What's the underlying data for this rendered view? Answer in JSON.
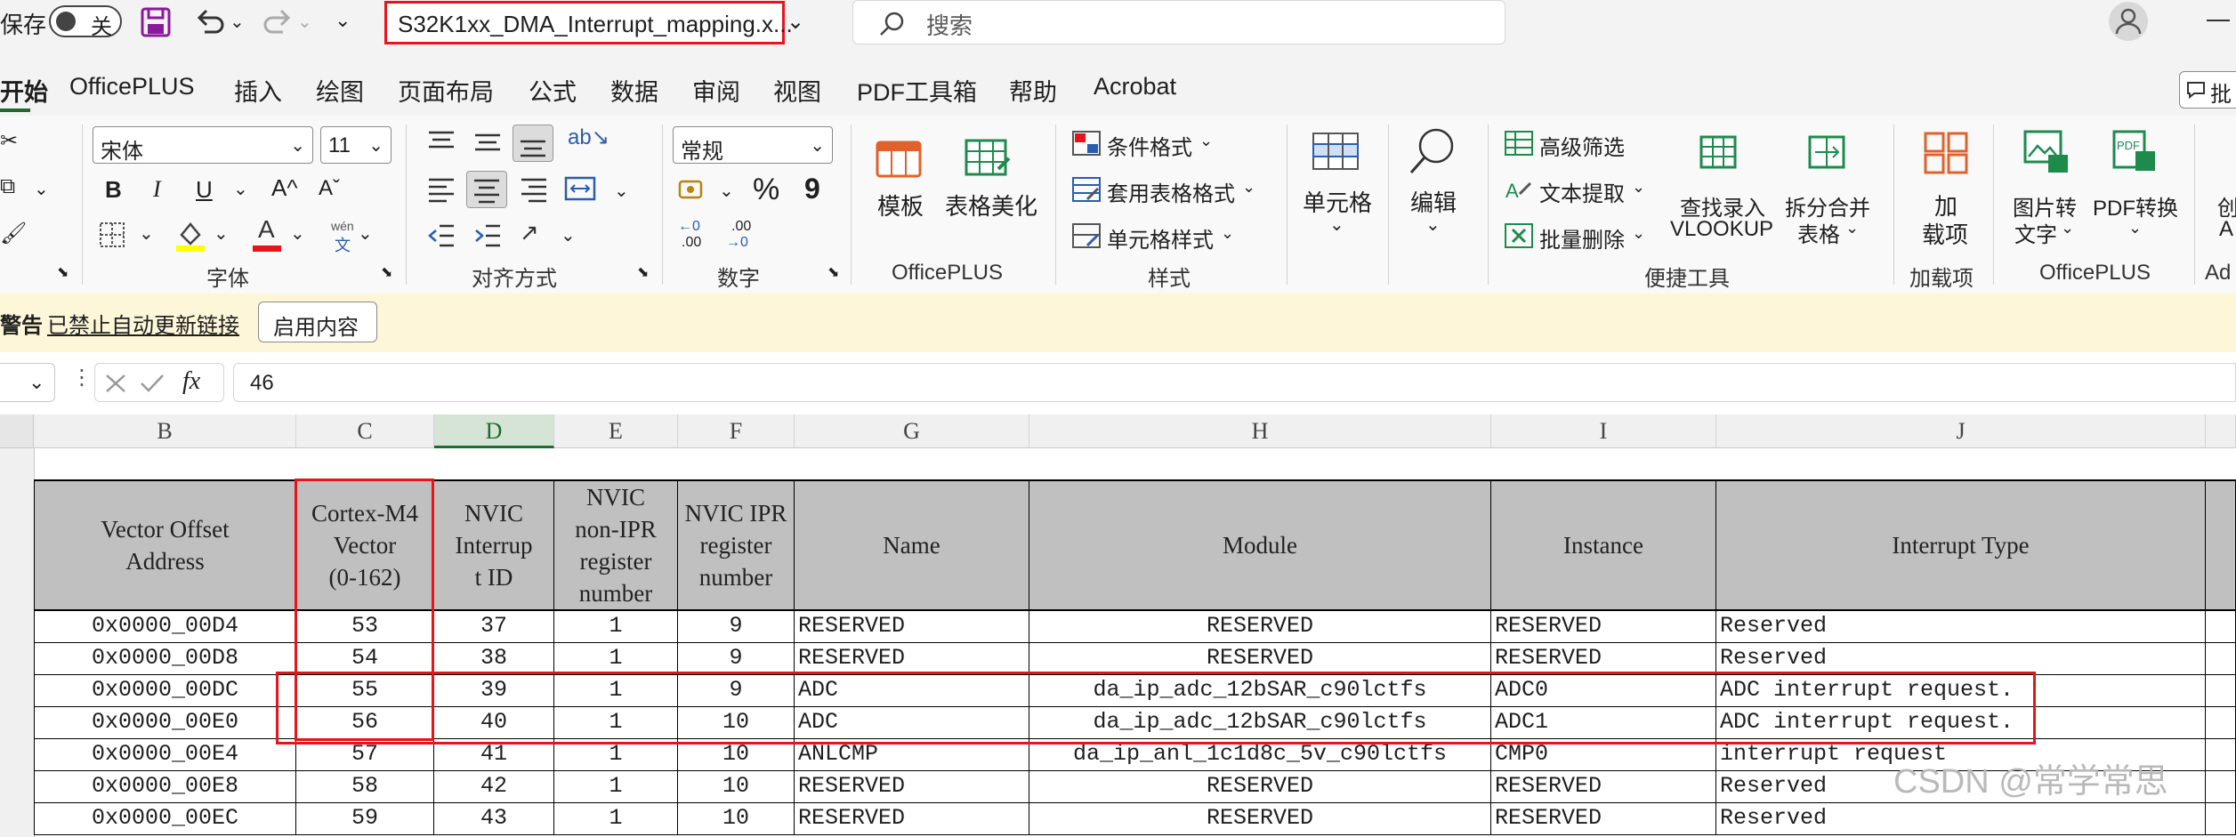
{
  "titlebar": {
    "autosave_label": "保存",
    "toggle_label": "关",
    "filename": "S32K1xx_DMA_Interrupt_mapping.x...",
    "search_placeholder": "搜索"
  },
  "menu": [
    "开始",
    "OfficePLUS",
    "插入",
    "绘图",
    "页面布局",
    "公式",
    "数据",
    "审阅",
    "视图",
    "PDF工具箱",
    "帮助",
    "Acrobat"
  ],
  "menu_right": "批",
  "ribbon": {
    "font_name": "宋体",
    "font_size": "11",
    "number_format": "常规",
    "bold": "B",
    "italic": "I",
    "underline": "U",
    "grow": "A^",
    "shrink": "Aˇ",
    "percent": "%",
    "comma": "9",
    "dec_inc": ".00",
    "dec_dec": ".00",
    "wen": "wén",
    "groups": {
      "font": "字体",
      "align": "对齐方式",
      "number": "数字",
      "officeplus1": "OfficePLUS",
      "style": "样式",
      "quick": "便捷工具",
      "addins": "加载项",
      "officeplus2": "OfficePLUS",
      "ad": "Ad"
    },
    "template": "模板",
    "table_beautify": "表格美化",
    "cond_format": "条件格式",
    "table_format": "套用表格格式",
    "cell_style": "单元格样式",
    "cells": "单元格",
    "edit": "编辑",
    "adv_filter": "高级筛选",
    "text_extract": "文本提取",
    "batch_delete": "批量删除",
    "vlookup_l1": "查找录入",
    "vlookup_l2": "VLOOKUP",
    "split_l1": "拆分合并",
    "split_l2": "表格",
    "addin_l1": "加",
    "addin_l2": "载项",
    "img2text_l1": "图片转",
    "img2text_l2": "文字",
    "pdfconv": "PDF转换",
    "right_l1": "创",
    "right_l2": "A"
  },
  "messagebar": {
    "warning": "警告",
    "link": "已禁止自动更新链接",
    "button": "启用内容"
  },
  "formula": {
    "value": "46",
    "fx": "fx"
  },
  "sheet": {
    "columns": [
      "B",
      "C",
      "D",
      "E",
      "F",
      "G",
      "H",
      "I",
      "J"
    ],
    "headers": [
      "Vector Offset\nAddress",
      "Cortex-M4\nVector\n(0-162)",
      "NVIC\nInterrup\nt ID",
      "NVIC\nnon-IPR\nregister\nnumber",
      "NVIC IPR\nregister\nnumber",
      "Name",
      "Module",
      "Instance",
      "Interrupt Type"
    ],
    "rows": [
      [
        "0x0000_00D4",
        "53",
        "37",
        "1",
        "9",
        "RESERVED",
        "RESERVED",
        "RESERVED",
        "Reserved"
      ],
      [
        "0x0000_00D8",
        "54",
        "38",
        "1",
        "9",
        "RESERVED",
        "RESERVED",
        "RESERVED",
        "Reserved"
      ],
      [
        "0x0000_00DC",
        "55",
        "39",
        "1",
        "9",
        "ADC",
        "da_ip_adc_12bSAR_c90lctfs",
        "ADC0",
        "ADC interrupt request."
      ],
      [
        "0x0000_00E0",
        "56",
        "40",
        "1",
        "10",
        "ADC",
        "da_ip_adc_12bSAR_c90lctfs",
        "ADC1",
        "ADC interrupt request."
      ],
      [
        "0x0000_00E4",
        "57",
        "41",
        "1",
        "10",
        "ANLCMP",
        "da_ip_anl_1c1d8c_5v_c90lctfs",
        "CMP0",
        "interrupt request"
      ],
      [
        "0x0000_00E8",
        "58",
        "42",
        "1",
        "10",
        "RESERVED",
        "RESERVED",
        "RESERVED",
        "Reserved"
      ],
      [
        "0x0000_00EC",
        "59",
        "43",
        "1",
        "10",
        "RESERVED",
        "RESERVED",
        "RESERVED",
        "Reserved"
      ]
    ]
  },
  "watermark": "CSDN @常学常思",
  "colors": {
    "highlight": "#e8141b",
    "header_fill": "#c0c0c0",
    "selected_col": "#1e6b31"
  }
}
